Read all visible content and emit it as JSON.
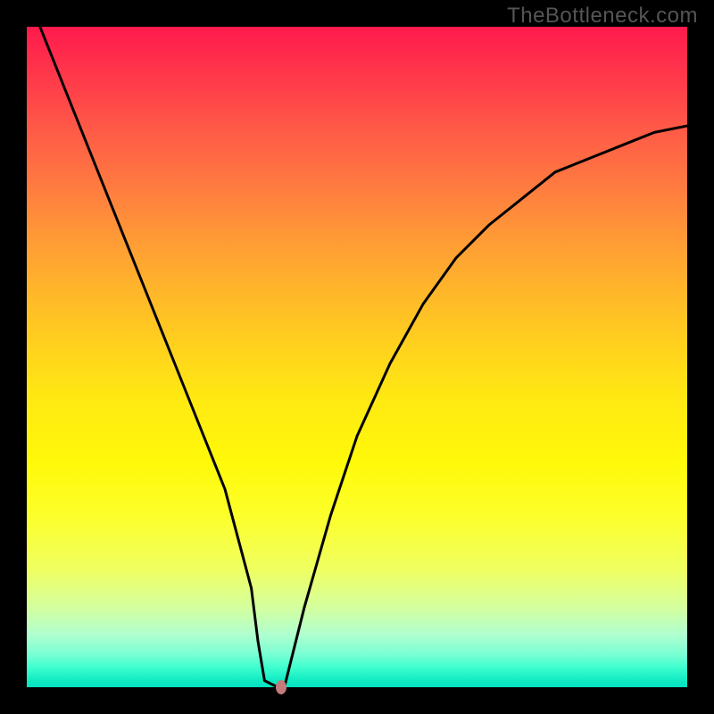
{
  "watermark": "TheBottleneck.com",
  "chart_data": {
    "type": "line",
    "title": "",
    "xlabel": "",
    "ylabel": "",
    "xlim": [
      0,
      100
    ],
    "ylim": [
      0,
      100
    ],
    "grid": false,
    "series": [
      {
        "name": "curve",
        "x": [
          2,
          6,
          10,
          14,
          18,
          22,
          26,
          30,
          34,
          35,
          36,
          38,
          39,
          40,
          42,
          46,
          50,
          55,
          60,
          65,
          70,
          75,
          80,
          85,
          90,
          95,
          100
        ],
        "y": [
          100,
          90,
          80,
          70,
          60,
          50,
          40,
          30,
          15,
          7,
          1,
          0,
          0,
          4,
          12,
          26,
          38,
          49,
          58,
          65,
          70,
          74,
          78,
          80,
          82,
          84,
          85
        ]
      }
    ],
    "marker": {
      "x": 38.5,
      "y": 0
    },
    "colors": {
      "curve": "#000000",
      "marker": "#c47b7b",
      "gradient_top": "#ff1a4d",
      "gradient_mid": "#ffe812",
      "gradient_bottom": "#05e1c0",
      "frame": "#000000"
    }
  }
}
